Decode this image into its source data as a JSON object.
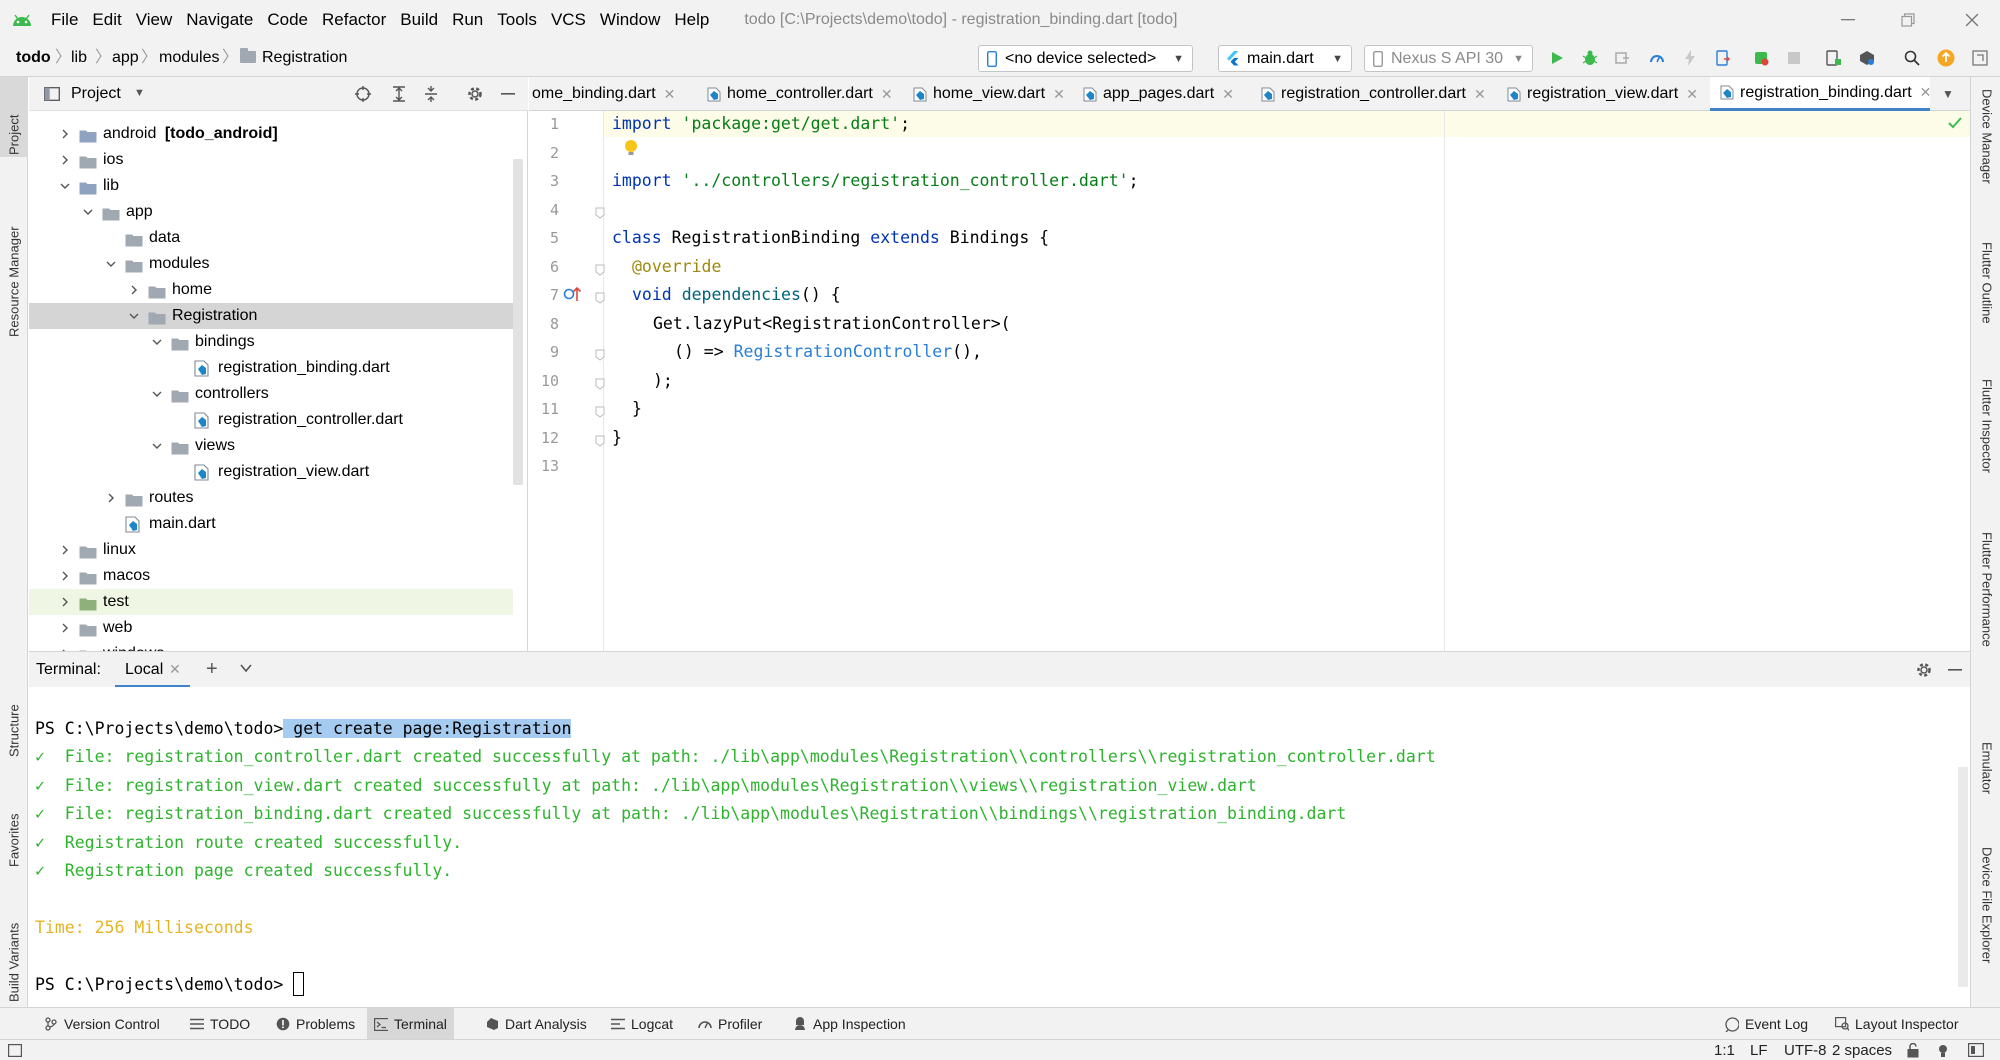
{
  "app": {
    "window_title": "todo [C:\\Projects\\demo\\todo] - registration_binding.dart [todo]",
    "menu": [
      "File",
      "Edit",
      "View",
      "Navigate",
      "Code",
      "Refactor",
      "Build",
      "Run",
      "Tools",
      "VCS",
      "Window",
      "Help"
    ],
    "accent": "#3dba4e"
  },
  "breadcrumb": [
    "todo",
    "lib",
    "app",
    "modules",
    "Registration"
  ],
  "toolbar": {
    "device_selector": "<no device selected>",
    "run_config": "main.dart",
    "emulator": "Nexus S API 30"
  },
  "project": {
    "title": "Project",
    "tree": [
      {
        "label": "android",
        "suffix": "[todo_android]",
        "type": "folder",
        "state": "collapsed"
      },
      {
        "label": "ios",
        "type": "folder",
        "state": "collapsed"
      },
      {
        "label": "lib",
        "type": "folder",
        "state": "expanded"
      },
      {
        "label": "app",
        "type": "folder",
        "state": "expanded"
      },
      {
        "label": "data",
        "type": "folder",
        "state": "leaf"
      },
      {
        "label": "modules",
        "type": "folder",
        "state": "expanded"
      },
      {
        "label": "home",
        "type": "folder",
        "state": "collapsed"
      },
      {
        "label": "Registration",
        "type": "folder",
        "state": "expanded",
        "selected": true
      },
      {
        "label": "bindings",
        "type": "folder",
        "state": "expanded"
      },
      {
        "label": "registration_binding.dart",
        "type": "dart"
      },
      {
        "label": "controllers",
        "type": "folder",
        "state": "expanded"
      },
      {
        "label": "registration_controller.dart",
        "type": "dart"
      },
      {
        "label": "views",
        "type": "folder",
        "state": "expanded"
      },
      {
        "label": "registration_view.dart",
        "type": "dart"
      },
      {
        "label": "routes",
        "type": "folder",
        "state": "collapsed"
      },
      {
        "label": "main.dart",
        "type": "dart"
      },
      {
        "label": "linux",
        "type": "folder",
        "state": "collapsed"
      },
      {
        "label": "macos",
        "type": "folder",
        "state": "collapsed"
      },
      {
        "label": "test",
        "type": "folder",
        "state": "collapsed",
        "highlight": true
      },
      {
        "label": "web",
        "type": "folder",
        "state": "collapsed"
      },
      {
        "label": "windows",
        "type": "folder",
        "state": "collapsed"
      }
    ]
  },
  "editor": {
    "tabs": [
      {
        "label": "ome_binding.dart",
        "active": false
      },
      {
        "label": "home_controller.dart",
        "active": false
      },
      {
        "label": "home_view.dart",
        "active": false
      },
      {
        "label": "app_pages.dart",
        "active": false
      },
      {
        "label": "registration_controller.dart",
        "active": false
      },
      {
        "label": "registration_view.dart",
        "active": false
      },
      {
        "label": "registration_binding.dart",
        "active": true
      }
    ],
    "line_numbers": [
      "1",
      "2",
      "3",
      "4",
      "5",
      "6",
      "7",
      "8",
      "9",
      "10",
      "11",
      "12",
      "13"
    ],
    "code": {
      "l1_kw": "import",
      "l1_str": "'package:get/get.dart'",
      "l1_end": ";",
      "l3_kw": "import",
      "l3_str": "'../controllers/registration_controller.dart'",
      "l3_end": ";",
      "l5_kw1": "class",
      "l5_name": " RegistrationBinding ",
      "l5_kw2": "extends",
      "l5_rest": " Bindings {",
      "l6": "@override",
      "l7_kw": "void",
      "l7_fn": "dependencies",
      "l7_rest": "() {",
      "l8": "Get.lazyPut<RegistrationController>(",
      "l9_pre": "() => ",
      "l9_ref": "RegistrationController",
      "l9_rest": "(),",
      "l10": ");",
      "l11": "}",
      "l12": "}"
    }
  },
  "terminal": {
    "label": "Terminal:",
    "tab": "Local",
    "prompt": "PS C:\\Projects\\demo\\todo>",
    "command": " get create page:Registration",
    "outputs": [
      "✓  File: registration_controller.dart created successfully at path: ./lib\\app\\modules\\Registration\\\\controllers\\\\registration_controller.dart",
      "✓  File: registration_view.dart created successfully at path: ./lib\\app\\modules\\Registration\\\\views\\\\registration_view.dart",
      "✓  File: registration_binding.dart created successfully at path: ./lib\\app\\modules\\Registration\\\\bindings\\\\registration_binding.dart",
      "✓  Registration route created successfully.",
      "✓  Registration page created successfully."
    ],
    "time": "Time: 256 Milliseconds",
    "prompt2": "PS C:\\Projects\\demo\\todo>"
  },
  "left_tabs": [
    "Project",
    "Resource Manager",
    "Structure",
    "Favorites",
    "Build Variants"
  ],
  "right_tabs": [
    "Device Manager",
    "Flutter Outline",
    "Flutter Inspector",
    "Flutter Performance",
    "Emulator",
    "Device File Explorer"
  ],
  "bottom_tools": [
    "Version Control",
    "TODO",
    "Problems",
    "Terminal",
    "Dart Analysis",
    "Logcat",
    "Profiler",
    "App Inspection"
  ],
  "bottom_right_tools": [
    "Event Log",
    "Layout Inspector"
  ],
  "status": {
    "position": "1:1",
    "line_sep": "LF",
    "encoding": "UTF-8",
    "indent": "2 spaces"
  }
}
